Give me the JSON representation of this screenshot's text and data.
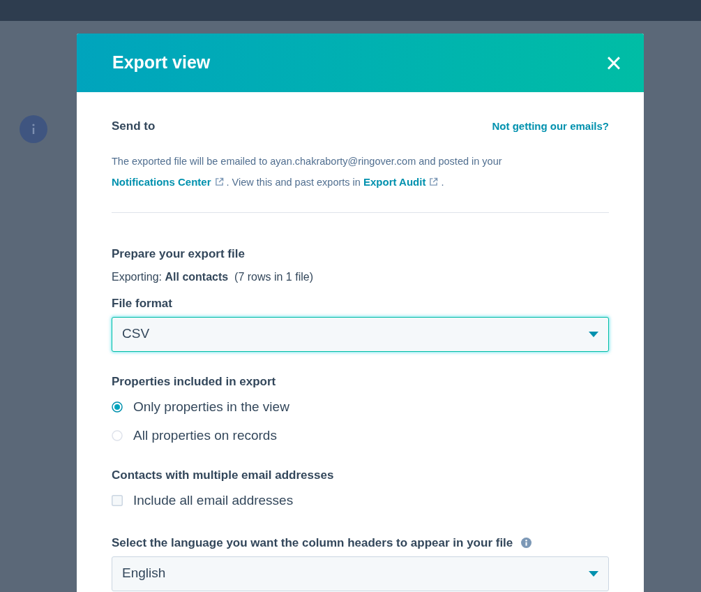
{
  "dialog": {
    "title": "Export view",
    "close": "×"
  },
  "send_to": {
    "heading": "Send to",
    "help_link": "Not getting our emails?",
    "notice": [
      {
        "kind": "text",
        "text": "The exported file will be emailed to ayan.chakraborty@ringover.com and posted in your "
      },
      {
        "kind": "link",
        "text": "Notifications Center"
      },
      {
        "kind": "text",
        "text": " . View this and past exports in "
      },
      {
        "kind": "link",
        "text": "Export Audit"
      },
      {
        "kind": "text",
        "text": " ."
      }
    ]
  },
  "prepare": {
    "heading": "Prepare your export file",
    "exporting": "Exporting: **All contacts**  (7 rows in 1 file)",
    "file_format": {
      "label": "File format",
      "value": "CSV",
      "focused": true
    },
    "properties": {
      "label": "Properties included in export",
      "options": [
        {
          "label": "Only properties in the view",
          "selected": true
        },
        {
          "label": "All properties on records",
          "selected": false
        }
      ]
    },
    "multiple_emails": {
      "label": "Contacts with multiple email addresses",
      "option": {
        "label": "Include all email addresses",
        "checked": false
      }
    },
    "language": {
      "label": "Select the language you want the column headers to appear in your file",
      "value": "English",
      "focused": false
    }
  }
}
